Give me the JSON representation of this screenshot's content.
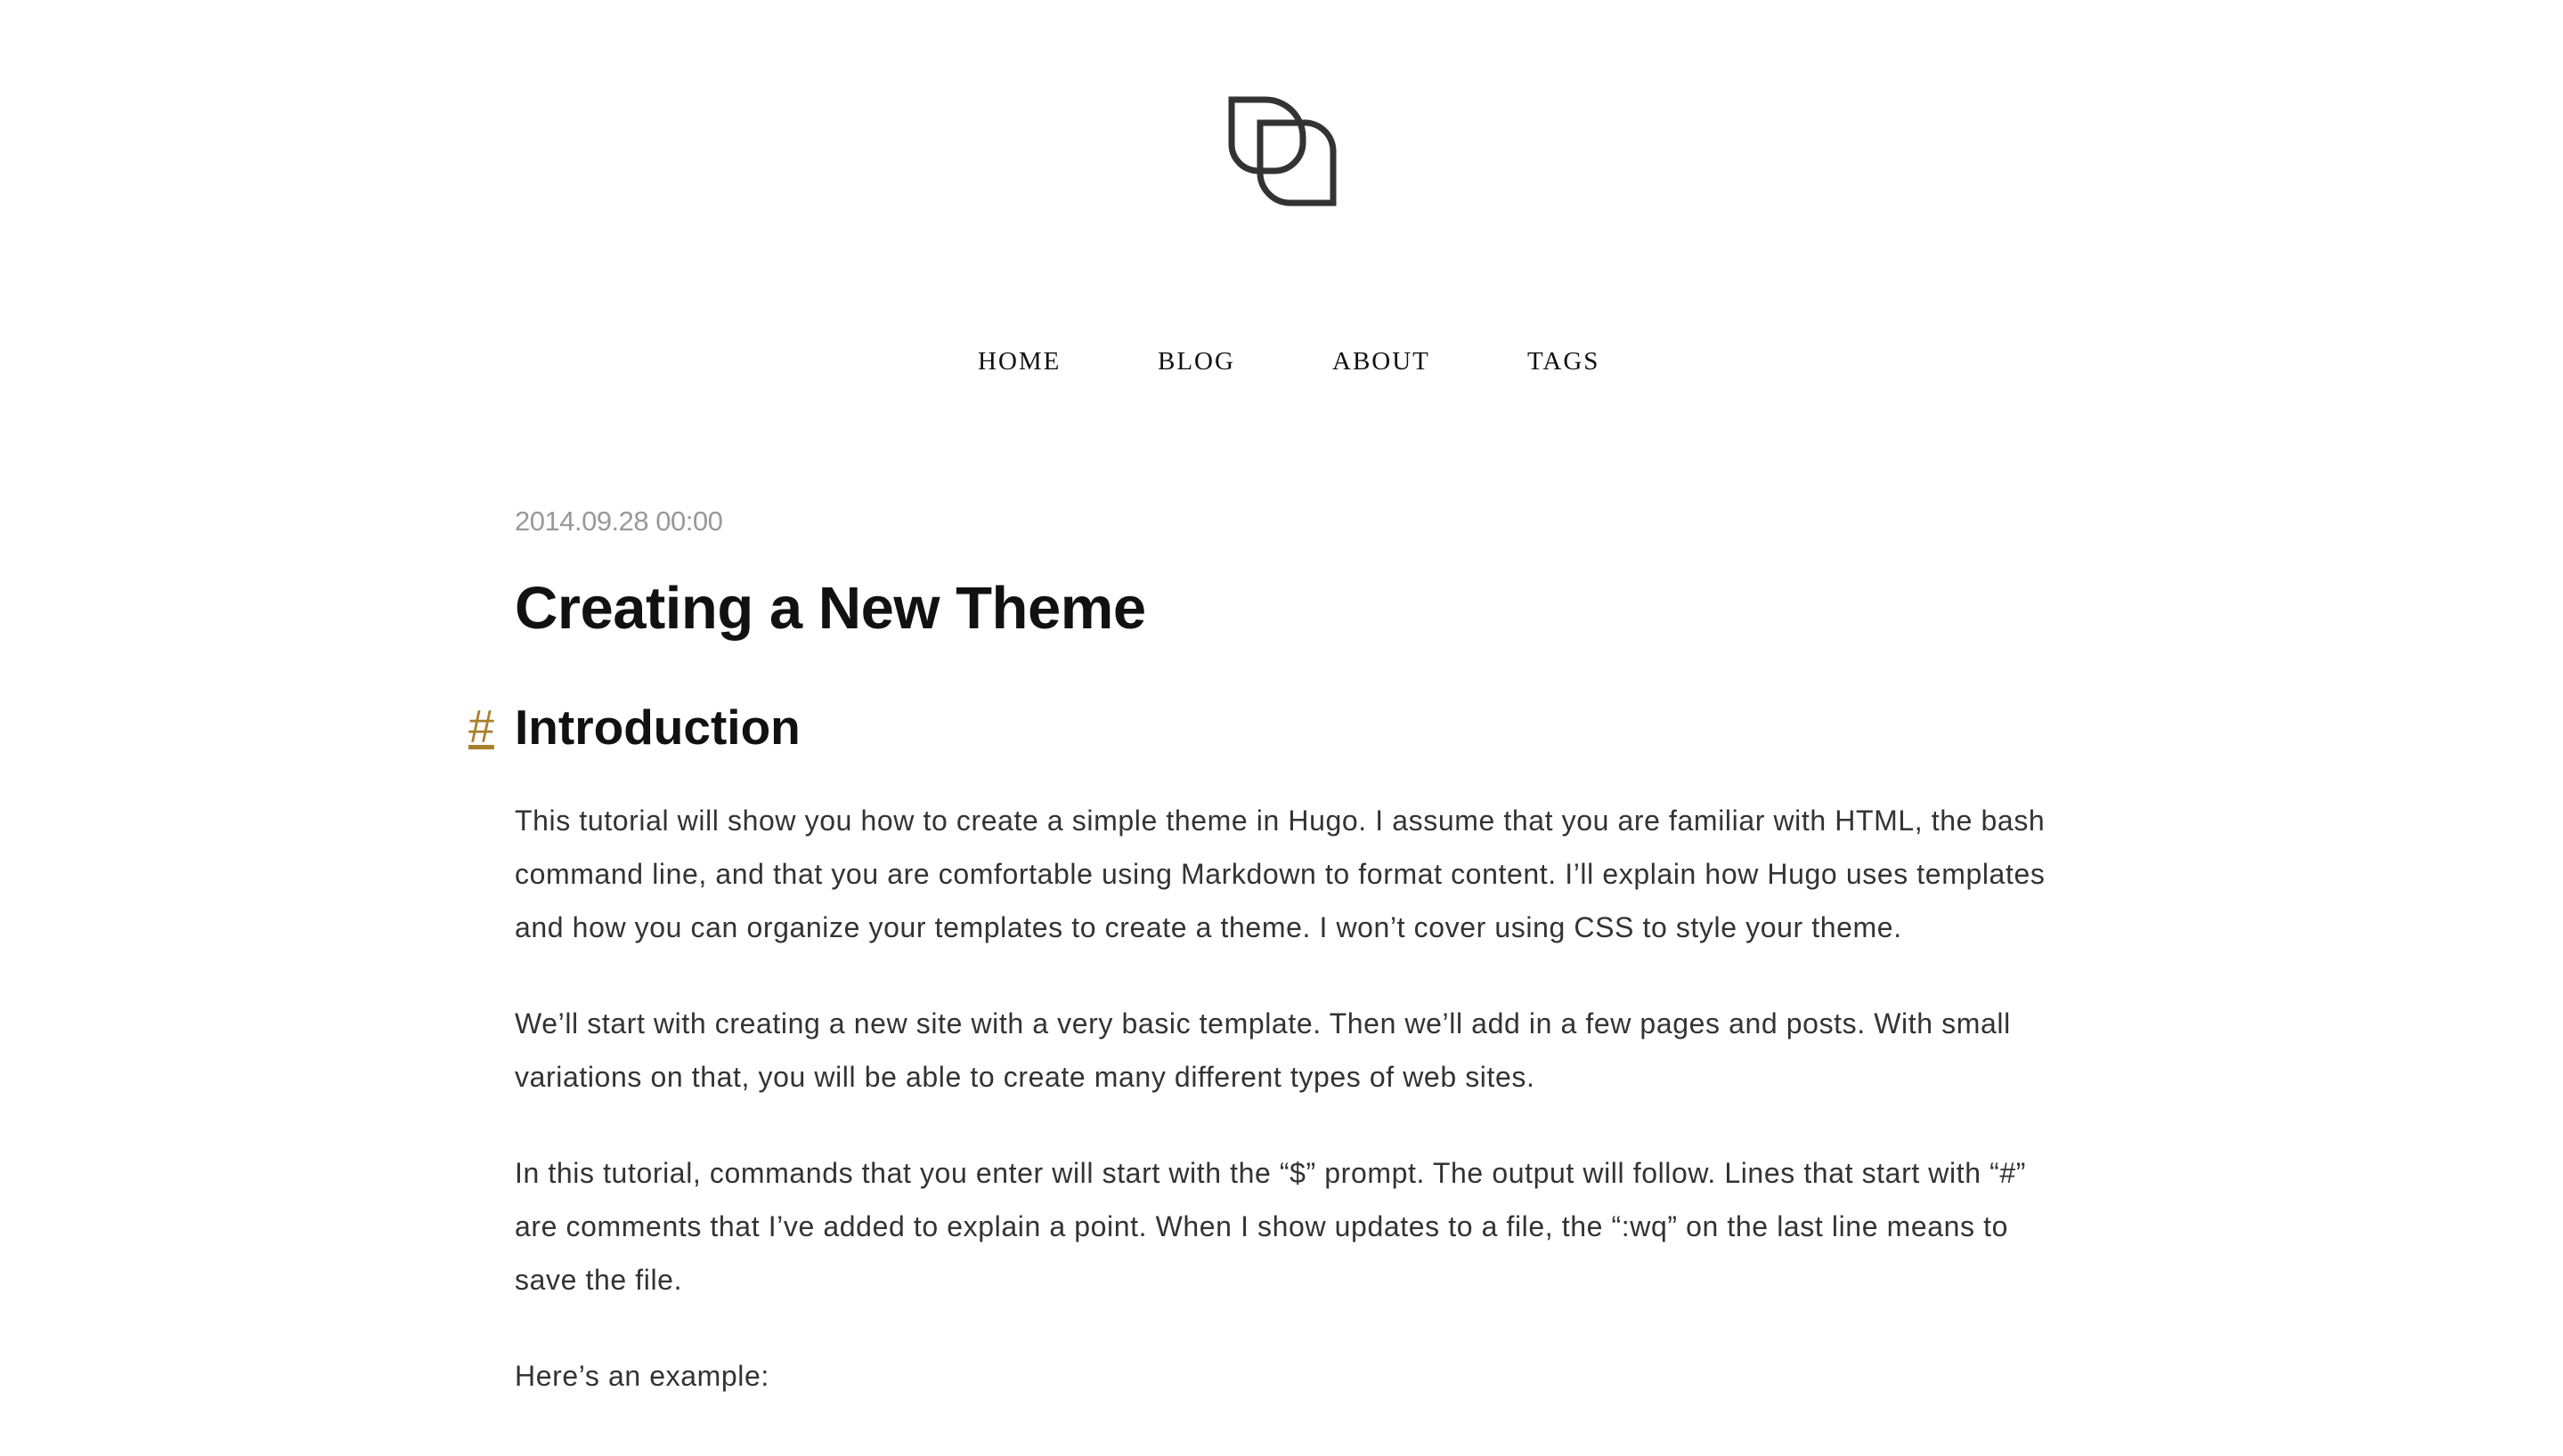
{
  "logo": {
    "icon": "overlapping-squares-logo",
    "color": "#333333"
  },
  "nav": {
    "items": [
      {
        "label": "HOME"
      },
      {
        "label": "BLOG"
      },
      {
        "label": "ABOUT"
      },
      {
        "label": "TAGS"
      }
    ]
  },
  "post": {
    "date": "2014.09.28 00:00",
    "title": "Creating a New Theme",
    "section": {
      "anchor": "#",
      "heading": "Introduction",
      "anchor_color": "#a8802a"
    },
    "paragraphs": [
      "This tutorial will show you how to create a simple theme in Hugo. I assume that you are familiar with HTML, the bash command line, and that you are comfortable using Markdown to format content. I’ll explain how Hugo uses templates and how you can organize your templates to create a theme. I won’t cover using CSS to style your theme.",
      "We’ll start with creating a new site with a very basic template. Then we’ll add in a few pages and posts. With small variations on that, you will be able to create many different types of web sites.",
      "In this tutorial, commands that you enter will start with the “$” prompt. The output will follow. Lines that start with “#” are comments that I’ve added to explain a point. When I show updates to a file, the “:wq” on the last line means to save the file.",
      "Here’s an example:"
    ]
  }
}
